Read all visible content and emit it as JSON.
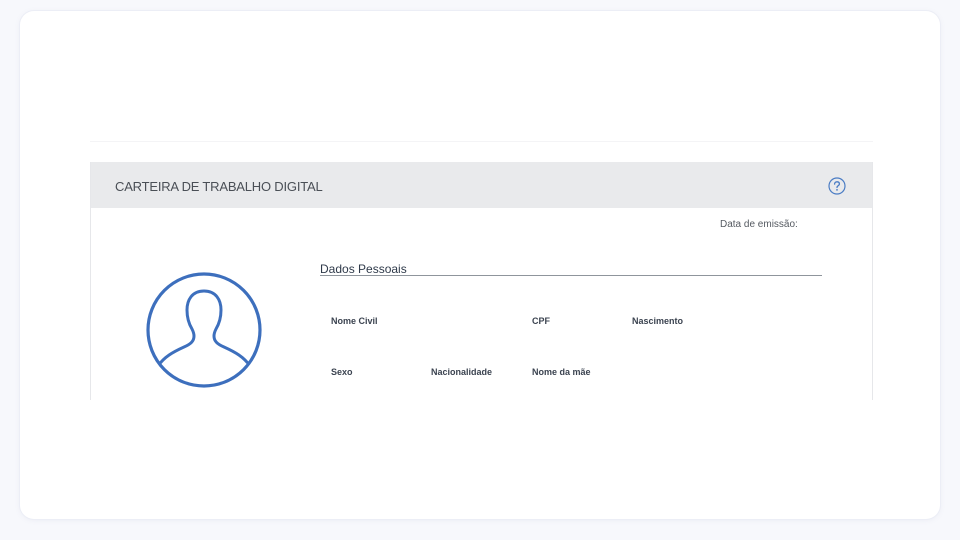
{
  "panel": {
    "title": "CARTEIRA DE TRABALHO DIGITAL",
    "help_icon": "question-circle-icon",
    "issue_date_label": "Data de emissão:"
  },
  "avatar": {
    "icon": "user-silhouette-icon",
    "color": "#3d6fbd"
  },
  "personal_data": {
    "title": "Dados Pessoais",
    "fields": {
      "civil_name": "Nome Civil",
      "cpf": "CPF",
      "birth": "Nascimento",
      "sex": "Sexo",
      "nationality": "Nacionalidade",
      "mother_name": "Nome da mãe"
    }
  },
  "colors": {
    "header_background": "#e9eaec",
    "help_icon": "#4a7cc4"
  }
}
